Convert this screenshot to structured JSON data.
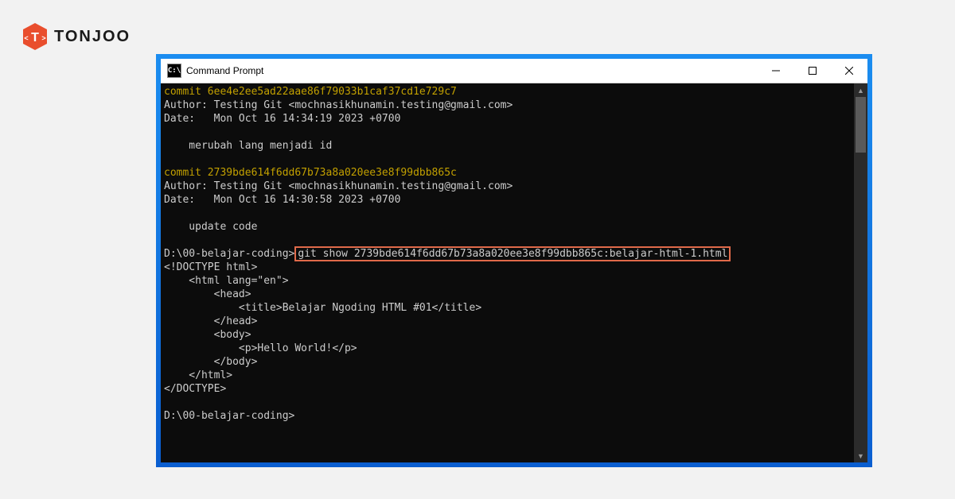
{
  "brand": {
    "name": "TONJOO"
  },
  "window": {
    "title": "Command Prompt"
  },
  "log": {
    "commit1": {
      "line": "commit 6ee4e2ee5ad22aae86f79033b1caf37cd1e729c7",
      "author": "Author: Testing Git <mochnasikhunamin.testing@gmail.com>",
      "date": "Date:   Mon Oct 16 14:34:19 2023 +0700",
      "msg": "    merubah lang menjadi id"
    },
    "commit2": {
      "line": "commit 2739bde614f6dd67b73a8a020ee3e8f99dbb865c",
      "author": "Author: Testing Git <mochnasikhunamin.testing@gmail.com>",
      "date": "Date:   Mon Oct 16 14:30:58 2023 +0700",
      "msg": "    update code"
    },
    "prompt1_path": "D:\\00-belajar-coding>",
    "prompt1_cmd": "git show 2739bde614f6dd67b73a8a020ee3e8f99dbb865c:belajar-html-1.html",
    "out": {
      "l1": "<!DOCTYPE html>",
      "l2": "    <html lang=\"en\">",
      "l3": "        <head>",
      "l4": "            <title>Belajar Ngoding HTML #01</title>",
      "l5": "        </head>",
      "l6": "        <body>",
      "l7": "            <p>Hello World!</p>",
      "l8": "        </body>",
      "l9": "    </html>",
      "l10": "</DOCTYPE>"
    },
    "prompt2": "D:\\00-belajar-coding>"
  }
}
